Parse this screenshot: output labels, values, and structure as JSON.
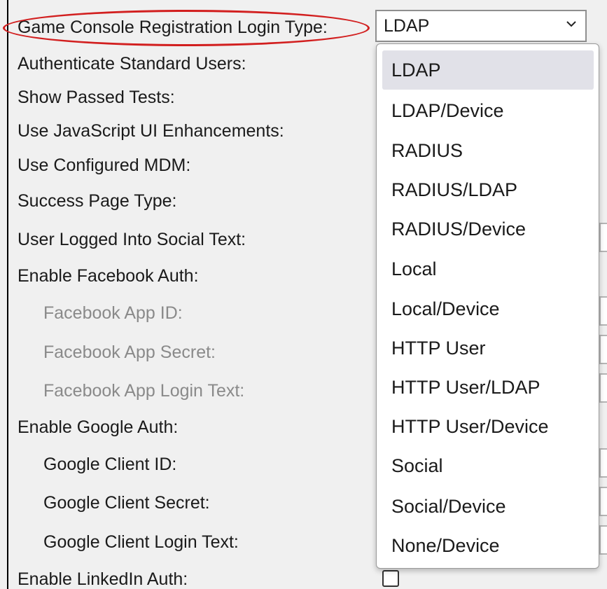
{
  "form": {
    "labels": [
      "Game Console Registration Login Type:",
      "Authenticate Standard Users:",
      "Show Passed Tests:",
      "Use JavaScript UI Enhancements:",
      "Use Configured MDM:",
      "Success Page Type:",
      "User Logged Into Social Text:",
      "Enable Facebook Auth:",
      "Facebook App ID:",
      "Facebook App Secret:",
      "Facebook App Login Text:",
      "Enable Google Auth:",
      "Google Client ID:",
      "Google Client Secret:",
      "Google Client Login Text:",
      "Enable LinkedIn Auth:"
    ]
  },
  "login_type_select": {
    "value": "LDAP",
    "options": [
      "LDAP",
      "LDAP/Device",
      "RADIUS",
      "RADIUS/LDAP",
      "RADIUS/Device",
      "Local",
      "Local/Device",
      "HTTP User",
      "HTTP User/LDAP",
      "HTTP User/Device",
      "Social",
      "Social/Device",
      "None/Device"
    ],
    "selected_index": 0
  },
  "colors": {
    "annotation": "#d21f1f",
    "disabled_text": "#8a8a8a",
    "selected_option_bg": "#e1e1e8"
  }
}
